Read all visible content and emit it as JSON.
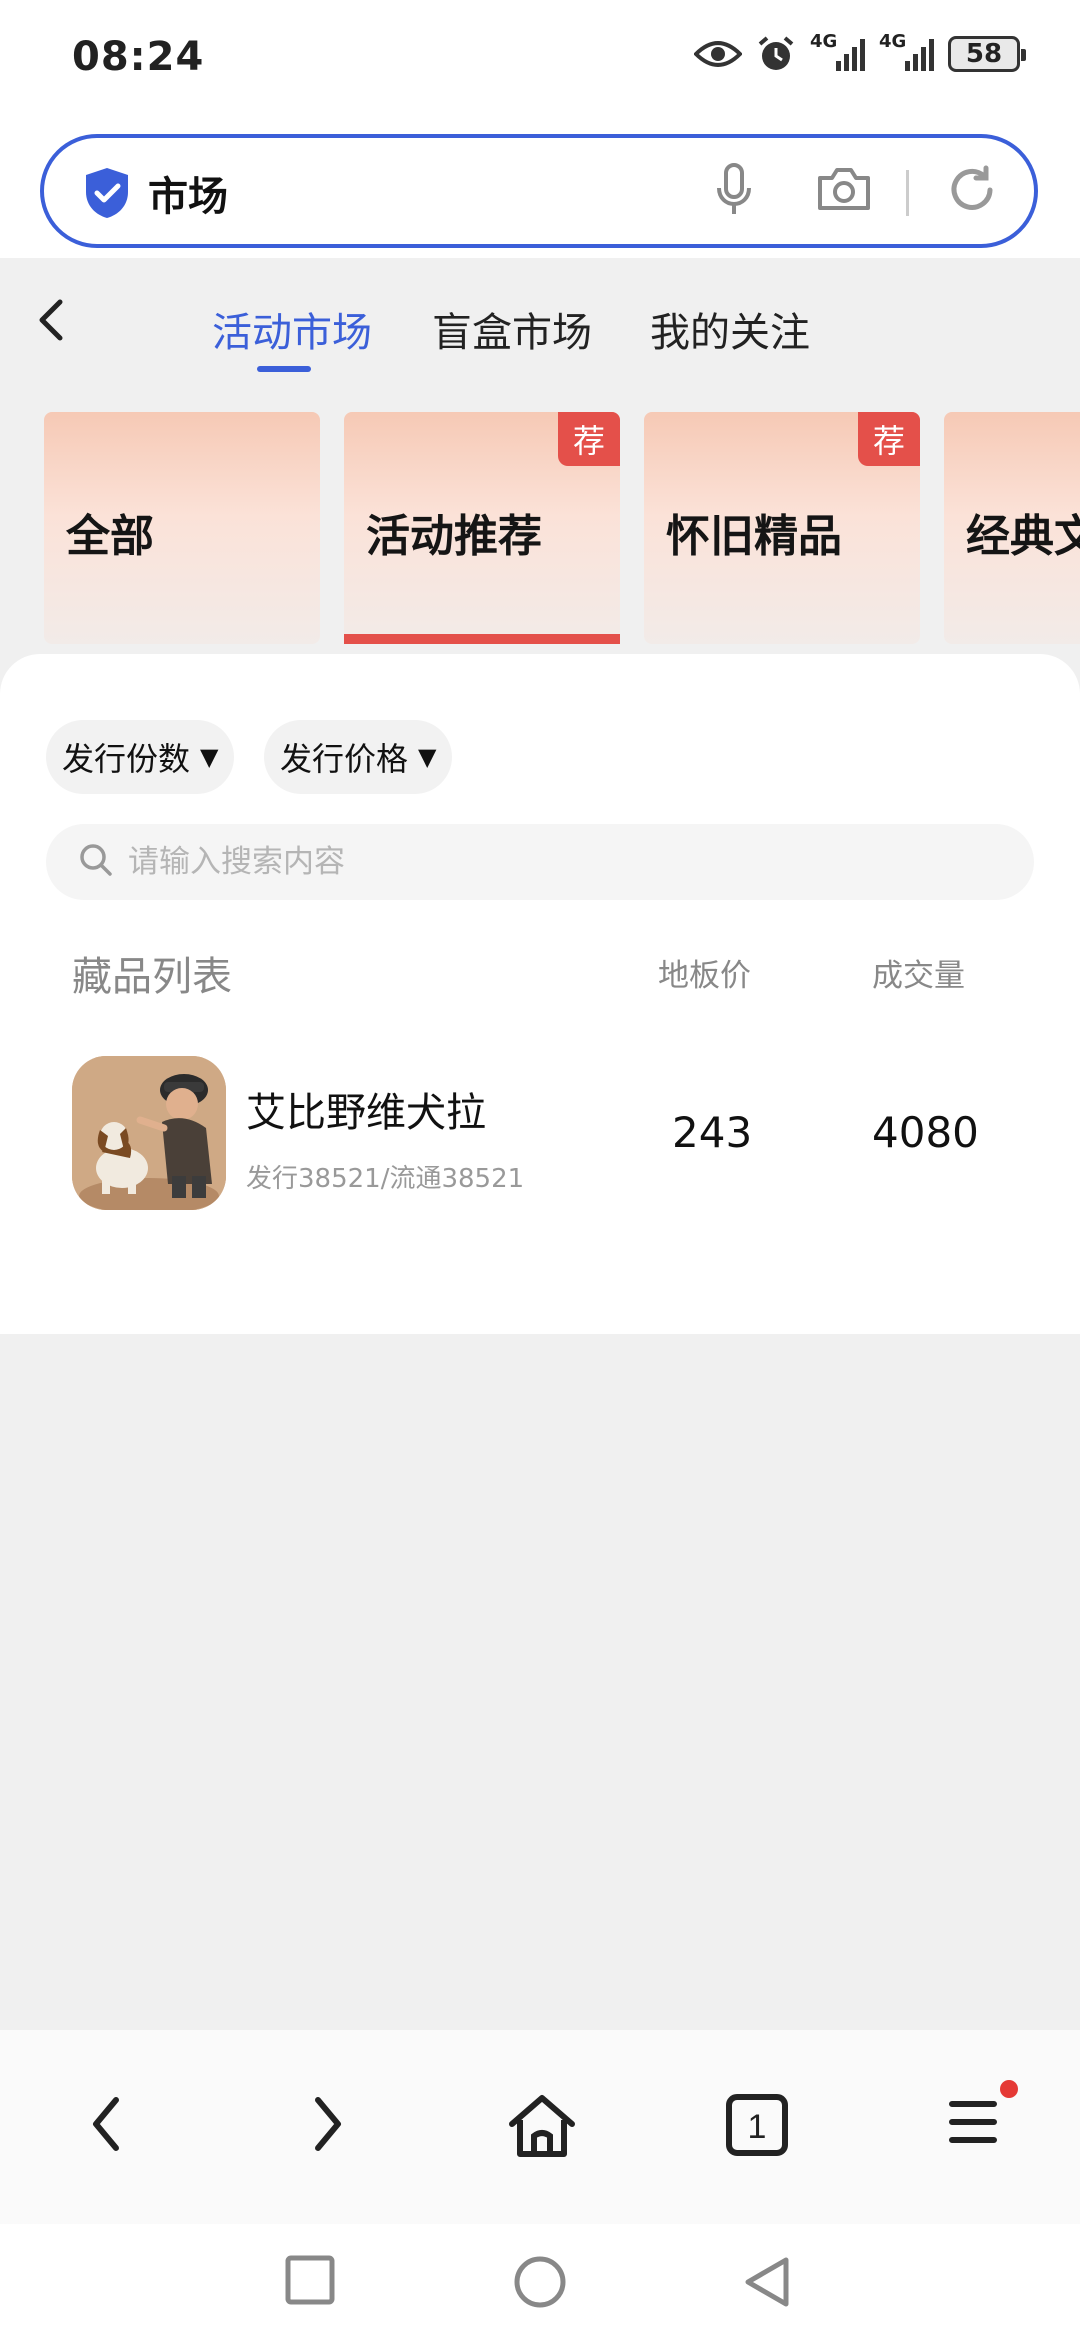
{
  "status_bar": {
    "time": "08:24",
    "network_1": "4G",
    "network_2": "4G",
    "battery": "58",
    "icons": [
      "eye-icon",
      "alarm-icon",
      "signal-icon",
      "signal-icon",
      "battery-icon"
    ]
  },
  "browser": {
    "search_query": "市场",
    "icons": [
      "shield-icon",
      "mic-icon",
      "camera-icon",
      "refresh-icon"
    ],
    "accent_color": "#3b5fd9"
  },
  "tabs": [
    {
      "label": "活动市场",
      "active": true
    },
    {
      "label": "盲盒市场",
      "active": false
    },
    {
      "label": "我的关注",
      "active": false
    }
  ],
  "categories": [
    {
      "label": "全部",
      "tag": ""
    },
    {
      "label": "活动推荐",
      "tag": "荐",
      "selected": true
    },
    {
      "label": "怀旧精品",
      "tag": "荐"
    },
    {
      "label": "经典文"
    }
  ],
  "filters": {
    "quantity": "发行份数",
    "price": "发行价格"
  },
  "search": {
    "placeholder": "请输入搜索内容"
  },
  "list": {
    "title": "藏品列表",
    "col_price": "地板价",
    "col_volume": "成交量",
    "items": [
      {
        "name": "艾比野维犬拉",
        "sub": "发行38521/流通38521",
        "price": "243",
        "volume": "4080"
      }
    ]
  },
  "bottom_nav": {
    "tab_count": "1",
    "icons": [
      "back-icon",
      "forward-icon",
      "home-icon",
      "tabs-icon",
      "menu-icon"
    ]
  },
  "colors": {
    "tag_red": "#e4504a",
    "card_peach": "#f6c9b5"
  }
}
